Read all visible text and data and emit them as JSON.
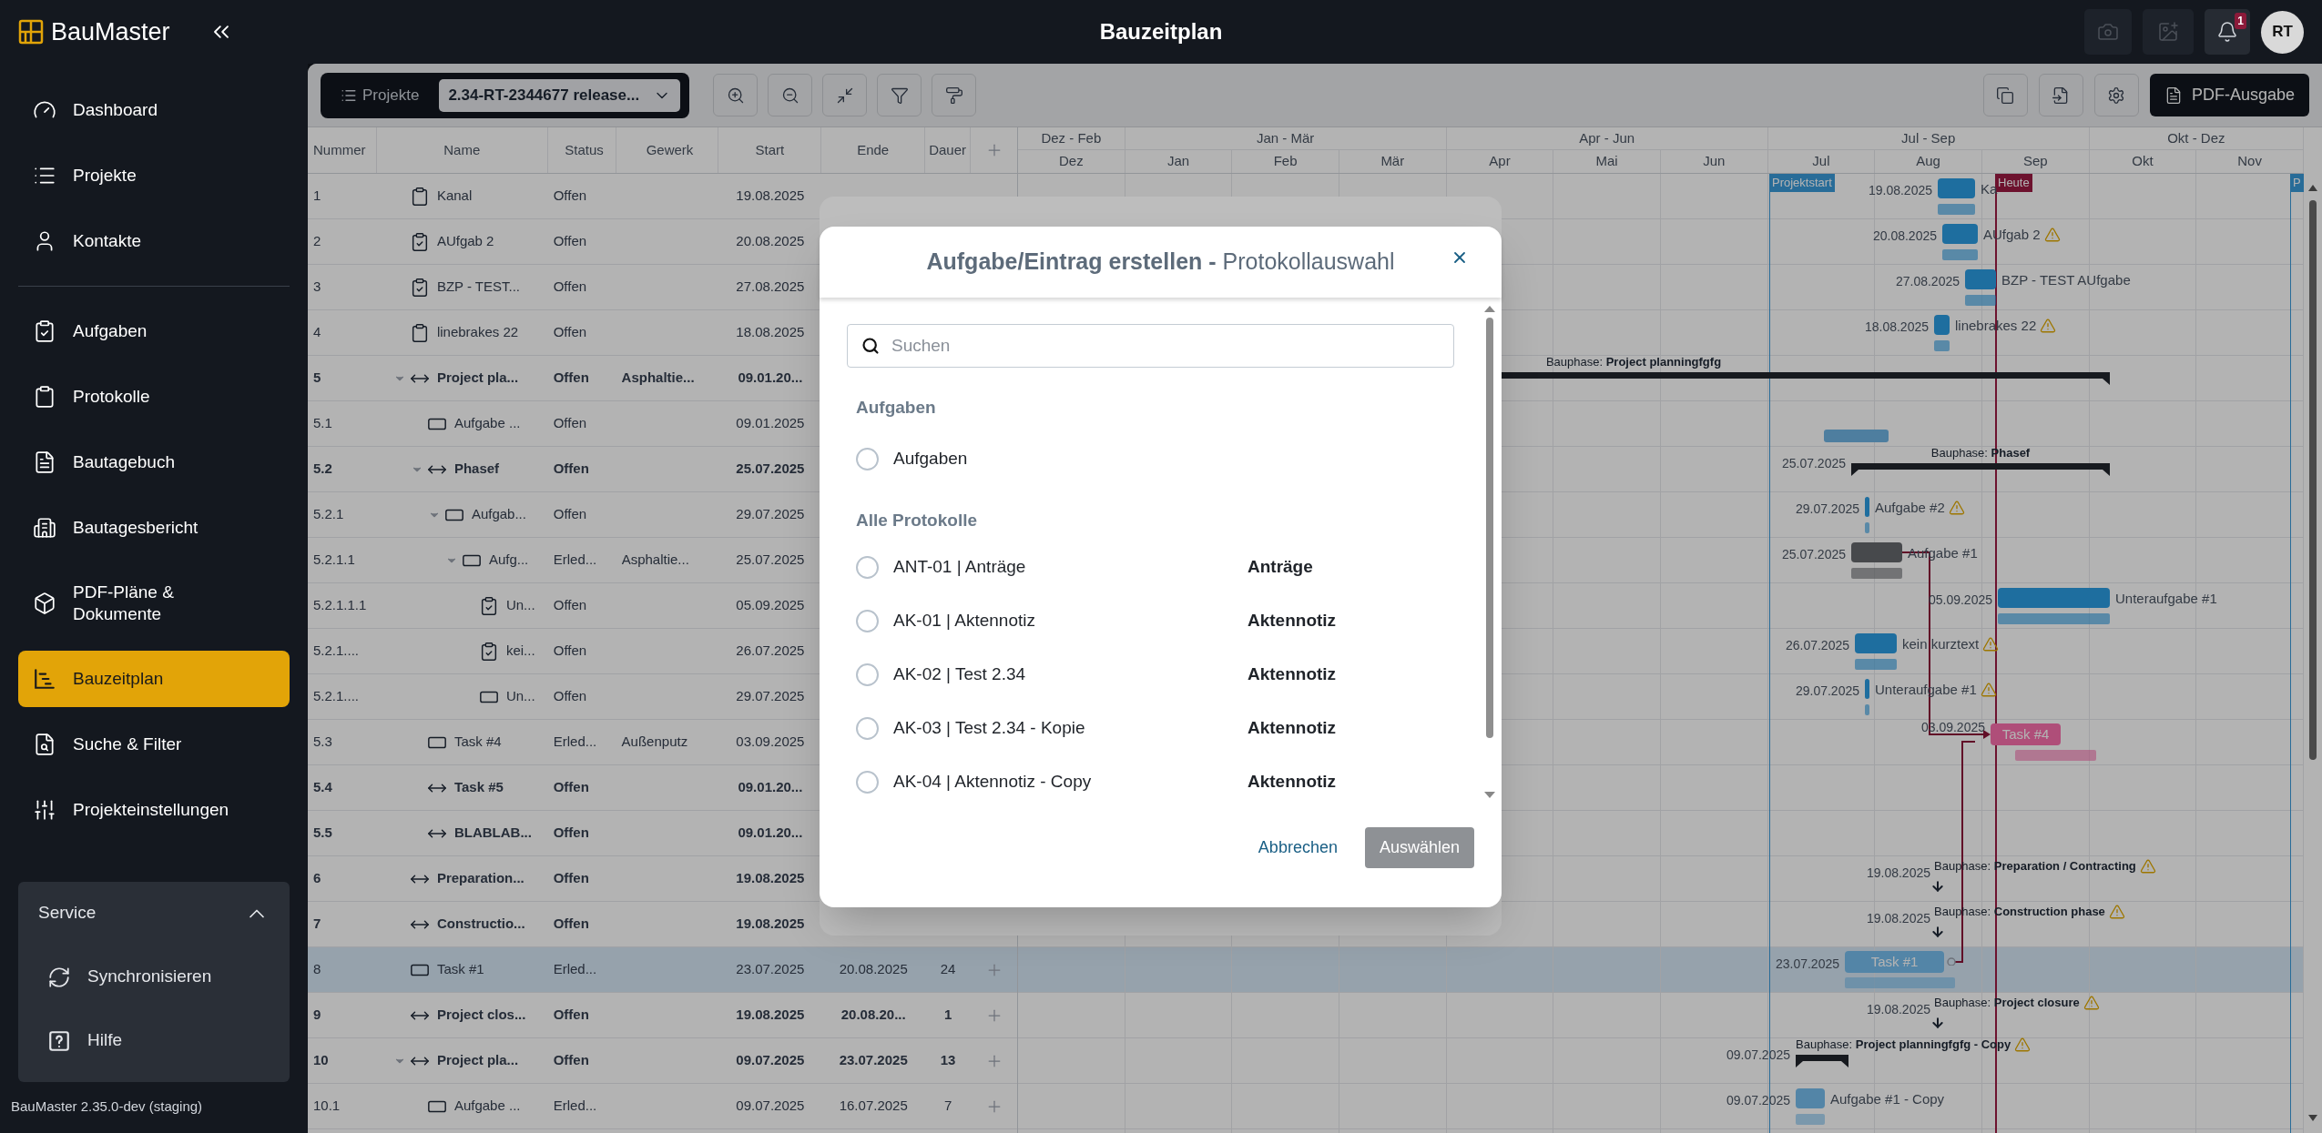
{
  "app": {
    "logo": "BauMaster",
    "title": "Bauzeitplan",
    "notification_count": "1",
    "avatar": "RT"
  },
  "sidebar": {
    "groups": [
      {
        "items": [
          {
            "label": "Dashboard",
            "selected": false
          },
          {
            "label": "Projekte",
            "selected": false
          },
          {
            "label": "Kontakte",
            "selected": false
          }
        ]
      },
      {
        "items": [
          {
            "label": "Aufgaben",
            "selected": false
          },
          {
            "label": "Protokolle",
            "selected": false
          },
          {
            "label": "Bautagebuch",
            "selected": false
          },
          {
            "label": "Bautagesbericht",
            "selected": false
          },
          {
            "label": "PDF-Pläne & Dokumente",
            "selected": false
          },
          {
            "label": "Bauzeitplan",
            "selected": true
          },
          {
            "label": "Suche & Filter",
            "selected": false
          },
          {
            "label": "Projekteinstellungen",
            "selected": false
          }
        ]
      }
    ],
    "service": {
      "title": "Service",
      "expanded": true,
      "items": [
        {
          "label": "Synchronisieren"
        },
        {
          "label": "Hilfe"
        }
      ]
    },
    "version": "BauMaster 2.35.0-dev (staging)"
  },
  "toolbar": {
    "projects_label": "Projekte",
    "project": "2.34-RT-2344677 release...",
    "export_button": "PDF-Ausgabe"
  },
  "table": {
    "columns": [
      "Nummer",
      "Name",
      "Status",
      "Gewerk",
      "Start",
      "Ende",
      "Dauer"
    ],
    "rows": [
      {
        "number": "1",
        "kind": "task",
        "name": "Kanal",
        "status": "Offen",
        "start": "19.08.2025",
        "selected": false
      },
      {
        "number": "2",
        "kind": "checked-task",
        "name": "AUfgab 2",
        "status": "Offen",
        "start": "20.08.2025",
        "selected": false
      },
      {
        "number": "3",
        "kind": "checked-task",
        "name": "BZP - TEST...",
        "status": "Offen",
        "start": "27.08.2025",
        "selected": false
      },
      {
        "number": "4",
        "kind": "task",
        "name": "linebrakes 22",
        "status": "Offen",
        "start": "18.08.2025",
        "selected": false
      },
      {
        "number": "5",
        "kind": "phase",
        "name": "Project pla...",
        "status": "Offen",
        "trade": "Asphaltie...",
        "start": "09.01.20...",
        "selected": false,
        "expanded": true,
        "children": [
          {
            "number": "5.1",
            "kind": "activity",
            "name": "Aufgabe ...",
            "status": "Offen",
            "start": "09.01.2025",
            "selected": false
          },
          {
            "number": "5.2",
            "kind": "phase",
            "name": "Phasef",
            "status": "Offen",
            "start": "25.07.2025",
            "selected": false,
            "expanded": true,
            "children": [
              {
                "number": "5.2.1",
                "kind": "activity",
                "name": "Aufgab...",
                "status": "Offen",
                "start": "29.07.2025",
                "selected": false,
                "expanded": true,
                "children": [
                  {
                    "number": "5.2.1.1",
                    "kind": "activity",
                    "name": "Aufg...",
                    "status": "Erled...",
                    "trade": "Asphaltie...",
                    "start": "25.07.2025",
                    "selected": false,
                    "expanded": true,
                    "children": [
                      {
                        "number": "5.2.1.1.1",
                        "kind": "checked-task",
                        "name": "Un...",
                        "status": "Offen",
                        "start": "05.09.2025",
                        "selected": false
                      },
                      {
                        "number": "5.2.1....",
                        "kind": "checked-task",
                        "name": "kei...",
                        "status": "Offen",
                        "start": "26.07.2025",
                        "selected": false
                      },
                      {
                        "number": "5.2.1....",
                        "kind": "activity",
                        "name": "Un...",
                        "status": "Offen",
                        "start": "29.07.2025",
                        "selected": false
                      }
                    ]
                  }
                ]
              }
            ]
          },
          {
            "number": "5.3",
            "kind": "activity",
            "name": "Task #4",
            "status": "Erled...",
            "trade": "Außenputz",
            "start": "03.09.2025",
            "selected": false
          },
          {
            "number": "5.4",
            "kind": "phase",
            "name": "Task #5",
            "status": "Offen",
            "start": "09.01.20...",
            "selected": false
          },
          {
            "number": "5.5",
            "kind": "phase",
            "name": "BLABLAB...",
            "status": "Offen",
            "start": "09.01.20...",
            "selected": false
          }
        ]
      },
      {
        "number": "6",
        "kind": "phase",
        "name": "Preparation...",
        "status": "Offen",
        "start": "19.08.2025",
        "selected": false
      },
      {
        "number": "7",
        "kind": "phase",
        "name": "Constructio...",
        "status": "Offen",
        "start": "19.08.2025",
        "selected": false
      },
      {
        "number": "8",
        "kind": "activity",
        "name": "Task #1",
        "status": "Erled...",
        "start": "23.07.2025",
        "end": "20.08.2025",
        "duration": "24",
        "selected": true
      },
      {
        "number": "9",
        "kind": "phase",
        "name": "Project clos...",
        "status": "Offen",
        "start": "19.08.2025",
        "end": "20.08.20...",
        "duration": "1",
        "selected": false
      },
      {
        "number": "10",
        "kind": "phase",
        "name": "Project pla...",
        "status": "Offen",
        "start": "09.07.2025",
        "end": "23.07.2025",
        "duration": "13",
        "selected": false,
        "expanded": true,
        "children": [
          {
            "number": "10.1",
            "kind": "activity",
            "name": "Aufgabe ...",
            "status": "Erled...",
            "start": "09.07.2025",
            "end": "16.07.2025",
            "duration": "7",
            "selected": false
          }
        ]
      }
    ]
  },
  "gantt": {
    "quarters": [
      {
        "label": "Dez - Feb"
      },
      {
        "label": "Jan - Mär"
      },
      {
        "label": "Apr - Jun"
      },
      {
        "label": "Jul - Sep"
      },
      {
        "label": "Okt - Dez"
      }
    ],
    "months": [
      "Dez",
      "Jan",
      "Feb",
      "Mär",
      "Apr",
      "Mai",
      "Jun",
      "Jul",
      "Aug",
      "Sep",
      "Okt",
      "Nov"
    ],
    "markers": [
      {
        "label": "Projektstart",
        "kind": "start"
      },
      {
        "label": "Heute",
        "kind": "today"
      },
      {
        "label": "P",
        "kind": "start"
      }
    ],
    "items": [
      {
        "kind": "bar",
        "date": "19.08.2025",
        "label": "Ka",
        "warning": false,
        "color": "#1f6fa0"
      },
      {
        "kind": "bar",
        "date": "20.08.2025",
        "label": "AUfgab 2",
        "warning": true,
        "color": "#1f6fa0"
      },
      {
        "kind": "bar",
        "date": "27.08.2025",
        "label": "BZP - TEST AUfgabe",
        "warning": false,
        "color": "#1f6fa0"
      },
      {
        "kind": "bar",
        "date": "18.08.2025",
        "label": "linebrakes 22",
        "warning": true,
        "color": "#1f6fa0"
      },
      {
        "kind": "phase",
        "label": "Bauphase: **Project planningfgfg**",
        "warning": false
      },
      {
        "kind": "plan",
        "color": "#4f7fa0"
      },
      {
        "kind": "phase",
        "date": "25.07.2025",
        "label": "Bauphase: **Phasef**",
        "warning": false
      },
      {
        "kind": "bar",
        "date": "29.07.2025",
        "label": "Aufgabe #2",
        "warning": true,
        "color": "#1f6fa0"
      },
      {
        "kind": "bar",
        "date": "25.07.2025",
        "label": "Aufgabe #1",
        "warning": false,
        "color": "#484a4d"
      },
      {
        "kind": "bar",
        "date": "05.09.2025",
        "label": "Unteraufgabe #1",
        "warning": false,
        "color": "#1f6fa0"
      },
      {
        "kind": "bar",
        "date": "26.07.2025",
        "label": "kein kurztext",
        "warning": true,
        "color": "#1f6fa0"
      },
      {
        "kind": "bar",
        "date": "29.07.2025",
        "label": "Unteraufgabe #1",
        "warning": true,
        "color": "#1f6fa0"
      },
      {
        "kind": "labeled-bar",
        "date": "03.09.2025",
        "label": "Task #4",
        "color": "#b0507a"
      },
      {
        "kind": "milestone",
        "date": "19.08.2025",
        "label": "Bauphase: **Preparation / Contracting**",
        "warning": true
      },
      {
        "kind": "milestone",
        "date": "19.08.2025",
        "label": "Bauphase: **Construction phase**",
        "warning": true
      },
      {
        "kind": "labeled-bar",
        "date": "23.07.2025",
        "label": "Task #1",
        "color": "#5586a8"
      },
      {
        "kind": "milestone",
        "date": "19.08.2025",
        "label": "Bauphase: **Project closure**",
        "warning": true
      },
      {
        "kind": "phase",
        "date": "09.07.2025",
        "label": "Bauphase: **Project planningfgfg - Copy**",
        "warning": true
      },
      {
        "kind": "bar",
        "date": "09.07.2025",
        "label": "Aufgabe #1 - Copy",
        "warning": false,
        "color": "#5586a8"
      }
    ]
  },
  "dialog": {
    "title": "**Aufgabe/Eintrag erstellen -** Protokollauswahl",
    "search": {
      "placeholder": "Suchen"
    },
    "sections": [
      {
        "title": "Aufgaben",
        "options": [
          {
            "label": "Aufgaben",
            "selected": false
          }
        ]
      },
      {
        "title": "Alle Protokolle",
        "options": [
          {
            "label": "ANT-01 | Anträge",
            "type": "Anträge",
            "selected": false
          },
          {
            "label": "AK-01 | Aktennotiz",
            "type": "Aktennotiz",
            "selected": false
          },
          {
            "label": "AK-02 | Test 2.34",
            "type": "Aktennotiz",
            "selected": false
          },
          {
            "label": "AK-03 | Test 2.34 - Kopie",
            "type": "Aktennotiz",
            "selected": false
          },
          {
            "label": "AK-04 | Aktennotiz - Copy",
            "type": "Aktennotiz",
            "selected": false
          }
        ]
      }
    ],
    "cancel_button": "Abbrechen",
    "confirm_button": {
      "label": "Auswählen",
      "disabled": true
    }
  }
}
